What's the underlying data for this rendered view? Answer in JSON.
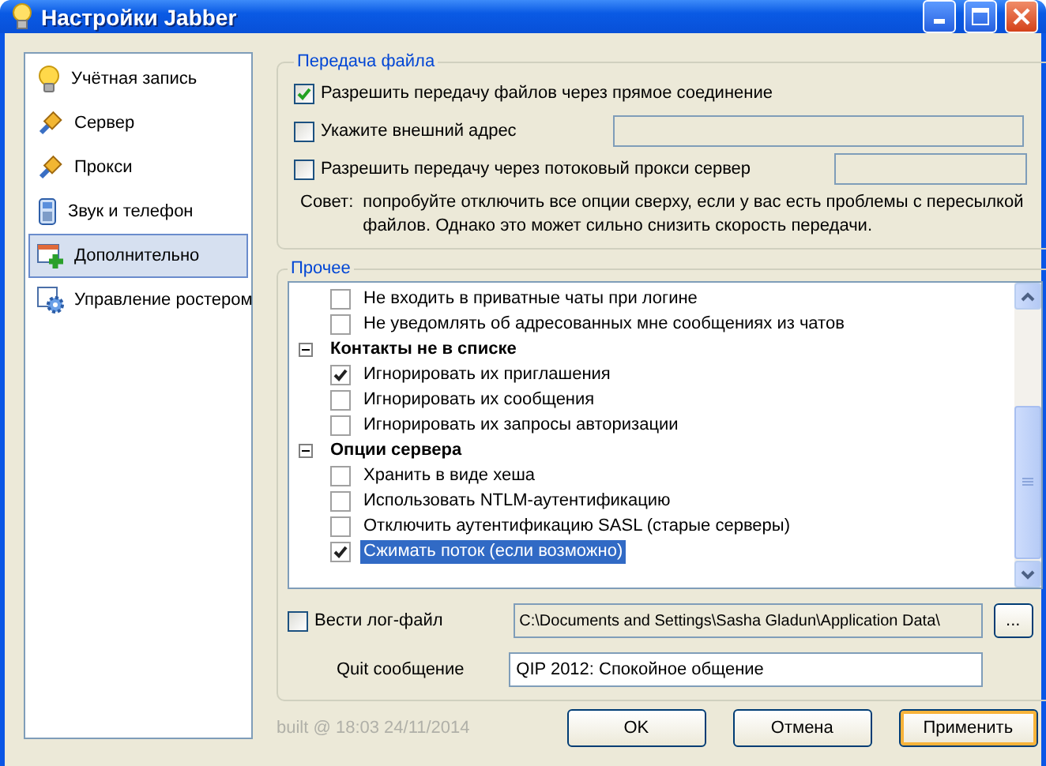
{
  "window": {
    "title": "Настройки Jabber"
  },
  "sidebar": {
    "items": [
      {
        "label": "Учётная запись",
        "selected": false
      },
      {
        "label": "Сервер",
        "selected": false
      },
      {
        "label": "Прокси",
        "selected": false
      },
      {
        "label": "Звук и телефон",
        "selected": false
      },
      {
        "label": "Дополнительно",
        "selected": true
      },
      {
        "label": "Управление ростером",
        "selected": false
      }
    ]
  },
  "file_transfer": {
    "title": "Передача файла",
    "options": [
      {
        "kind": "plain",
        "label": "Разрешить передачу файлов через прямое соединение",
        "checked": true
      },
      {
        "kind": "with-field",
        "label": "Укажите внешний адрес",
        "checked": false
      },
      {
        "kind": "with-field",
        "label": "Разрешить передачу через потоковый прокси сервер",
        "checked": false
      }
    ],
    "tip": {
      "label": "Совет:",
      "text": "попробуйте отключить все опции сверху, если у вас есть проблемы с пересылкой файлов. Однако это может сильно снизить скорость передачи."
    }
  },
  "other": {
    "title": "Прочее",
    "tree": [
      {
        "kind": "option",
        "label": "Не входить в приватные чаты при логине",
        "checked": false,
        "selected": false
      },
      {
        "kind": "option",
        "label": "Не уведомлять об адресованных мне сообщениях из чатов",
        "checked": false,
        "selected": false
      },
      {
        "kind": "group",
        "label": "Контакты не в списке",
        "expanded": true,
        "children": [
          {
            "kind": "option",
            "label": "Игнорировать их приглашения",
            "checked": true,
            "selected": false
          },
          {
            "kind": "option",
            "label": "Игнорировать их сообщения",
            "checked": false,
            "selected": false
          },
          {
            "kind": "option",
            "label": "Игнорировать их запросы авторизации",
            "checked": false,
            "selected": false
          }
        ]
      },
      {
        "kind": "group",
        "label": "Опции сервера",
        "expanded": true,
        "children": [
          {
            "kind": "option",
            "label": "Хранить в виде хеша",
            "checked": false,
            "selected": false
          },
          {
            "kind": "option",
            "label": "Использовать NTLM-аутентификацию",
            "checked": false,
            "selected": false
          },
          {
            "kind": "option",
            "label": "Отключить аутентификацию SASL (старые серверы)",
            "checked": false,
            "selected": false
          },
          {
            "kind": "option",
            "label": "Сжимать поток (если возможно)",
            "checked": true,
            "selected": true
          }
        ]
      }
    ],
    "log": {
      "label": "Вести лог-файл",
      "checked": false,
      "path": "C:\\Documents and Settings\\Sasha Gladun\\Application Data\\",
      "browse": "..."
    },
    "quit": {
      "label": "Quit сообщение",
      "value": "QIP 2012: Спокойное общение"
    }
  },
  "footer": {
    "build": "built @ 18:03 24/11/2014",
    "buttons": [
      {
        "label": "OK",
        "focused": false
      },
      {
        "label": "Отмена",
        "focused": false
      },
      {
        "label": "Применить",
        "focused": true
      }
    ]
  }
}
